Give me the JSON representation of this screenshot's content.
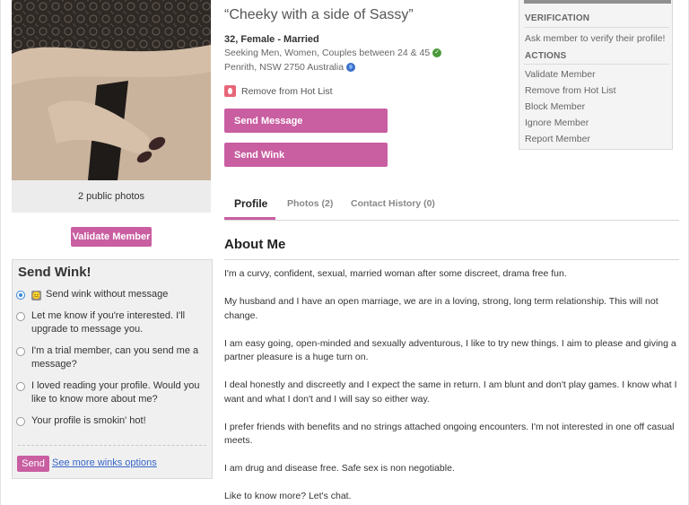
{
  "left": {
    "photo_caption": "2 public photos",
    "validate_label": "Validate Member",
    "wink": {
      "title": "Send Wink!",
      "options": [
        {
          "label": "Send wink without message",
          "checked": true,
          "emoji": "😐"
        },
        {
          "label": "Let me know if you're interested. I'll upgrade to message you.",
          "checked": false
        },
        {
          "label": "I'm a trial member, can you send me a message?",
          "checked": false
        },
        {
          "label": "I loved reading your profile. Would you like to know more about me?",
          "checked": false
        },
        {
          "label": "Your profile is smokin' hot!",
          "checked": false
        }
      ],
      "send_label": "Send",
      "more_label": "See more winks options"
    }
  },
  "profile": {
    "tagline": "“Cheeky with a side of Sassy”",
    "summary": "32, Female - Married",
    "seeking": "Seeking Men, Women, Couples between 24 & 45",
    "location": "Penrith, NSW 2750 Australia",
    "hotlist_label": "Remove from Hot List",
    "send_message_label": "Send Message",
    "send_wink_label": "Send Wink"
  },
  "tabs": [
    {
      "label": "Profile",
      "active": true
    },
    {
      "label": "Photos (2)",
      "active": false
    },
    {
      "label": "Contact History (0)",
      "active": false
    }
  ],
  "about": {
    "title": "About Me",
    "paragraphs": [
      "I'm a curvy, confident, sexual, married woman after some discreet, drama free fun.",
      "My husband and I have an open marriage, we are in a loving, strong, long term relationship. This will not change.",
      "I am easy going, open-minded and sexually adventurous, I like to try new things. I aim to please and giving a partner pleasure is a huge turn on.",
      "I deal honestly and discreetly and I expect the same in return. I am blunt and don't play games. I know what I want and what I don't and I will say so either way.",
      "I prefer friends with benefits and no strings attached ongoing encounters. I'm not interested in one off casual meets.",
      "I am drug and disease free. Safe sex is non negotiable.",
      "Like to know more? Let's chat."
    ]
  },
  "sidebar": {
    "verification_heading": "VERIFICATION",
    "verify_link": "Ask member to verify their profile!",
    "actions_heading": "ACTIONS",
    "actions": [
      "Validate Member",
      "Remove from Hot List",
      "Block Member",
      "Ignore Member",
      "Report Member"
    ]
  },
  "colors": {
    "accent": "#c95ea1",
    "link": "#3565c8",
    "verified": "#4a9a3a"
  }
}
